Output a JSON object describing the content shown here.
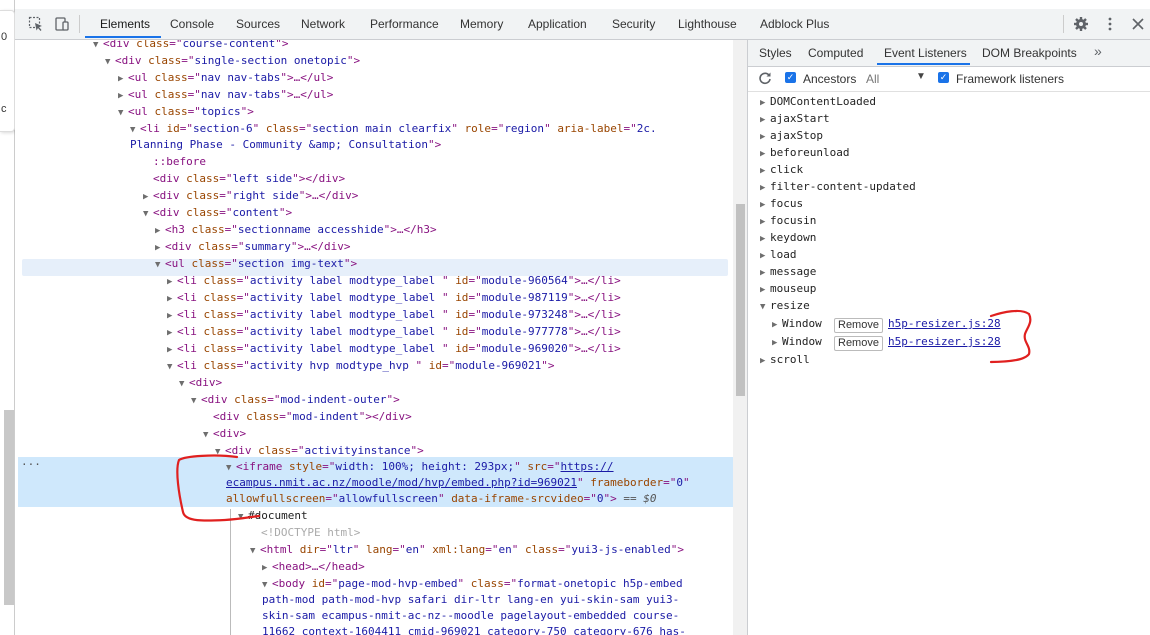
{
  "page_stub": {
    "lines": [
      "0",
      "c"
    ]
  },
  "toolbar": {
    "tabs": [
      "Elements",
      "Console",
      "Sources",
      "Network",
      "Performance",
      "Memory",
      "Application",
      "Security",
      "Lighthouse",
      "Adblock Plus"
    ],
    "active_tab": "Elements"
  },
  "dom_tree": {
    "rows": [
      [
        "▼",
        "<div ",
        "class",
        "course-content",
        ">"
      ],
      [
        "▼",
        "<div ",
        "class",
        "single-section onetopic",
        ">"
      ],
      [
        "▶",
        "<ul ",
        "class",
        "nav nav-tabs",
        ">…</ul>"
      ],
      [
        "▶",
        "<ul ",
        "class",
        "nav nav-tabs",
        ">…</ul>"
      ],
      [
        "▼",
        "<ul ",
        "class",
        "topics",
        ">"
      ]
    ],
    "section_li": {
      "open": "<li ",
      "id_attr": "id",
      "id_val": "section-6",
      "class_attr": "class",
      "class_val": "section main clearfix",
      "role_attr": "role",
      "role_val": "region",
      "aria_attr": "aria-label",
      "aria_val_1": "2c.",
      "aria_val_2": "Planning Phase - Community &amp; Consultation",
      "close": ">"
    },
    "before": "::before",
    "left_side": {
      "pre": "<div ",
      "attr": "class",
      "val": "left side",
      "post": "></div>"
    },
    "right_side": {
      "pre": "<div ",
      "attr": "class",
      "val": "right side",
      "post": ">…</div>"
    },
    "content_div": {
      "pre": "<div ",
      "attr": "class",
      "val": "content",
      "post": ">"
    },
    "h3": {
      "pre": "<h3 ",
      "attr": "class",
      "val": "sectionname accesshide",
      "post": ">…</h3>"
    },
    "summary": {
      "pre": "<div ",
      "attr": "class",
      "val": "summary",
      "post": ">…</div>"
    },
    "ul_section": {
      "pre": "<ul ",
      "attr": "class",
      "val": "section img-text",
      "post": ">"
    },
    "activities": [
      {
        "class": "activity label modtype_label ",
        "id": "module-960564"
      },
      {
        "class": "activity label modtype_label ",
        "id": "module-987119"
      },
      {
        "class": "activity label modtype_label ",
        "id": "module-973248"
      },
      {
        "class": "activity label modtype_label ",
        "id": "module-977778"
      },
      {
        "class": "activity label modtype_label ",
        "id": "module-969020"
      }
    ],
    "hvp_li": {
      "class": "activity hvp modtype_hvp ",
      "id": "module-969021"
    },
    "div_open": "<div>",
    "indent_outer": {
      "pre": "<div ",
      "attr": "class",
      "val": "mod-indent-outer",
      "post": ">"
    },
    "indent": {
      "pre": "<div ",
      "attr": "class",
      "val": "mod-indent",
      "post": "></div>"
    },
    "activityinstance": {
      "pre": "<div ",
      "attr": "class",
      "val": "activityinstance",
      "post": ">"
    },
    "iframe": {
      "open": "<iframe ",
      "style_attr": "style",
      "style_val": "width: 100%; height: 293px;",
      "src_attr": "src",
      "src_val_1": "https://",
      "src_val_2": "ecampus.nmit.ac.nz/moodle/mod/hvp/embed.php?id=969021",
      "fb_attr": "frameborder",
      "fb_val": "0",
      "afs_attr": "allowfullscreen",
      "afs_val": "allowfullscreen",
      "dis_attr": "data-iframe-srcvideo",
      "dis_val": "0",
      "close": ">",
      "eq": "== $0"
    },
    "document": "#document",
    "doctype": "<!DOCTYPE html>",
    "html_tag": {
      "pre": "<html ",
      "dir_attr": "dir",
      "dir_val": "ltr",
      "lang_attr": "lang",
      "lang_val": "en",
      "xml_attr": "xml:lang",
      "xml_val": "en",
      "class_attr": "class",
      "class_val": "yui3-js-enabled",
      "post": ">"
    },
    "head": "<head>…</head>",
    "body_tag": {
      "pre": "<body ",
      "id_attr": "id",
      "id_val": "page-mod-hvp-embed",
      "class_attr": "class",
      "class_val_1": "format-onetopic h5p-embed",
      "class_val_2": "path-mod path-mod-hvp safari dir-ltr lang-en yui-skin-sam yui3-",
      "class_val_3": "skin-sam ecampus-nmit-ac-nz--moodle pagelayout-embedded course-",
      "class_val_4": "11662 context-1604411 cmid-969021 category-750 category-676 has-"
    }
  },
  "side_panel": {
    "tabs": [
      "Styles",
      "Computed",
      "Event Listeners",
      "DOM Breakpoints"
    ],
    "active_tab": "Event Listeners",
    "ancestors_label": "Ancestors",
    "ancestors_checked": true,
    "filter_value": "All",
    "framework_label": "Framework listeners",
    "framework_checked": true,
    "events": [
      "DOMContentLoaded",
      "ajaxStart",
      "ajaxStop",
      "beforeunload",
      "click",
      "filter-content-updated",
      "focus",
      "focusin",
      "keydown",
      "load",
      "message",
      "mouseup",
      "resize"
    ],
    "resize_listeners": [
      {
        "target": "Window",
        "remove_label": "Remove",
        "source": "h5p-resizer.js:28"
      },
      {
        "target": "Window",
        "remove_label": "Remove",
        "source": "h5p-resizer.js:28"
      }
    ],
    "last_event": "scroll"
  },
  "colors": {
    "accent": "#1a73e8",
    "annotation": "#e0201f",
    "selection": "#cfe8fc"
  }
}
